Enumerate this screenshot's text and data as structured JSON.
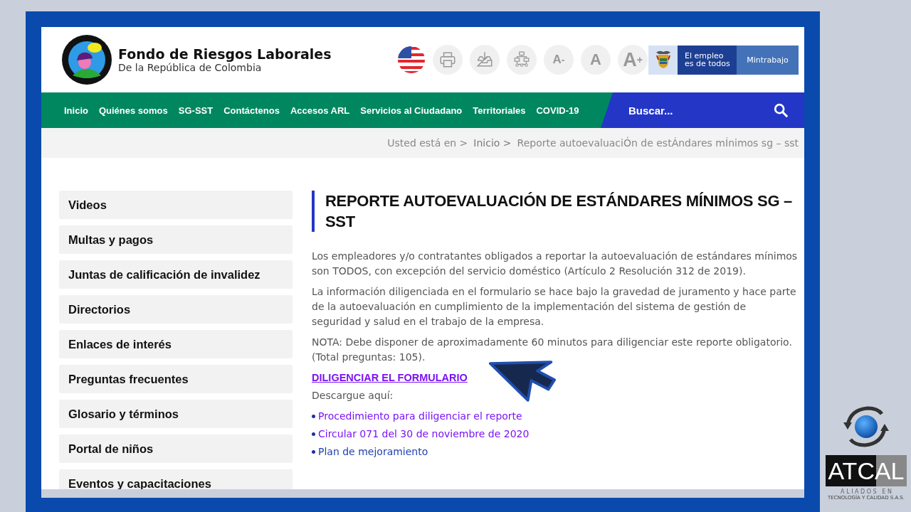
{
  "header": {
    "site_title": "Fondo de Riesgos Laborales",
    "site_subtitle": "De la República de Colombia",
    "tools": [
      {
        "kind": "flag"
      },
      {
        "kind": "print"
      },
      {
        "kind": "download"
      },
      {
        "kind": "sitemap"
      },
      {
        "kind": "text",
        "label": "A",
        "sup": "-"
      },
      {
        "kind": "text",
        "label": "A"
      },
      {
        "kind": "text",
        "label": "A",
        "sup": "+"
      }
    ],
    "banner": {
      "slogan_line1": "El empleo",
      "slogan_line2": "es de todos",
      "ministry": "Mintrabajo"
    }
  },
  "nav": {
    "items": [
      "Inicio",
      "Quiénes somos",
      "SG-SST",
      "Contáctenos",
      "Accesos ARL",
      "Servicios al Ciudadano",
      "Territoriales",
      "COVID-19"
    ],
    "search_placeholder": "Buscar..."
  },
  "breadcrumb": [
    {
      "text": "Usted está en >",
      "link": false
    },
    {
      "text": "Inicio >",
      "link": true
    },
    {
      "text": "Reporte autoevaluaciÓn de estÁndares mÍnimos sg – sst",
      "link": false
    }
  ],
  "sidebar": [
    "Videos",
    "Multas y pagos",
    "Juntas de calificación de invalidez",
    "Directorios",
    "Enlaces de interés",
    "Preguntas frecuentes",
    "Glosario y términos",
    "Portal de niños",
    "Eventos y capacitaciones"
  ],
  "article": {
    "title": "REPORTE AUTOEVALUACIÓN DE ESTÁNDARES MÍNIMOS SG – SST",
    "paragraphs": [
      "Los empleadores y/o contratantes obligados a reportar la autoevaluación de estándares mínimos son TODOS, con excepción del servicio doméstico (Artículo 2 Resolución 312 de 2019).",
      "La información diligenciada en el formulario se hace bajo la gravedad de juramento y hace parte de la autoevaluación en cumplimiento de la implementación del sistema de gestión de seguridad y salud en el trabajo de la empresa.",
      "NOTA: Debe disponer de aproximadamente 60 minutos para diligenciar este reporte obligatorio. (Total preguntas: 105)."
    ],
    "cta": "DILIGENCIAR EL FORMULARIO",
    "download_label": "Descargue aquí:",
    "downloads": [
      {
        "text": "Procedimiento para diligenciar el reporte",
        "visited": true
      },
      {
        "text": "Circular 071 del 30 de noviembre de 2020",
        "visited": true
      },
      {
        "text": "Plan de mejoramiento",
        "visited": false
      }
    ]
  },
  "brand": {
    "name": "ATCAL",
    "tagline1": "A L I A D O S   E N",
    "tagline2": "TECNOLOGÍA Y CALIDAD S.A.S."
  }
}
